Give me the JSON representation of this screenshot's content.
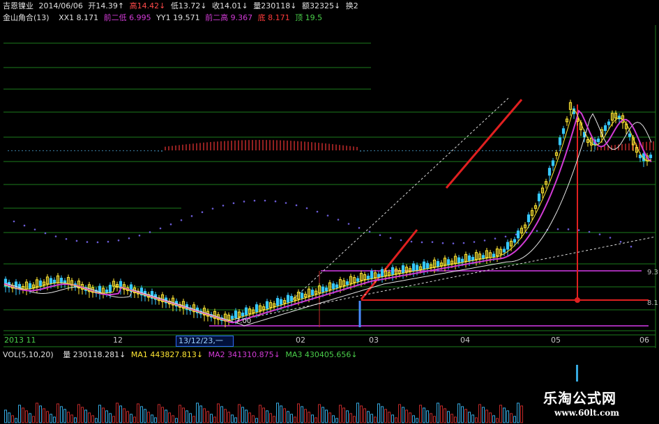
{
  "header": {
    "stock_name": "吉恩镍业",
    "date": "2014/06/06",
    "open_label": "开14.39↑",
    "high_label": "高14.42↓",
    "low_label": "低13.72↓",
    "close_label": "收14.01↓",
    "volume_label": "量230118↓",
    "amount_label": "额32325↓",
    "turnover_label": "换2"
  },
  "indicator": {
    "name": "金山角合(13)",
    "xx1": "XX1 8.171",
    "prev_low": "前二低 6.995",
    "yy1": "YY1 19.571",
    "prev_high": "前二高 9.367",
    "bottom": "底 8.171",
    "top": "顶 19.5"
  },
  "xaxis": {
    "year_month": "2013 11",
    "m12": "12",
    "selected_date": "13/12/23,一",
    "m02": "02",
    "m03": "03",
    "m04": "04",
    "m05": "05",
    "m06": "06"
  },
  "annotations": {
    "low_price": "7.00",
    "right_9": "9.3",
    "right_8": "8.1"
  },
  "vol": {
    "title": "VOL(5,10,20)",
    "amount": "量 230118.281↓",
    "ma1": "MA1 443827.813↓",
    "ma2": "MA2 341310.875↓",
    "ma3": "MA3 430405.656↓"
  },
  "watermark": {
    "site_name": "乐淘公式网",
    "site_url": "www.60lt.com"
  },
  "colors": {
    "up": "#ff3b3b",
    "down": "#36c9ff",
    "ma_white": "#e6e6e6",
    "ma_yellow": "#ffe733",
    "ma_magenta": "#d23bd6",
    "grid": "#1c7d1c",
    "line_red": "#e02020",
    "line_purple": "#a02cb0"
  }
}
